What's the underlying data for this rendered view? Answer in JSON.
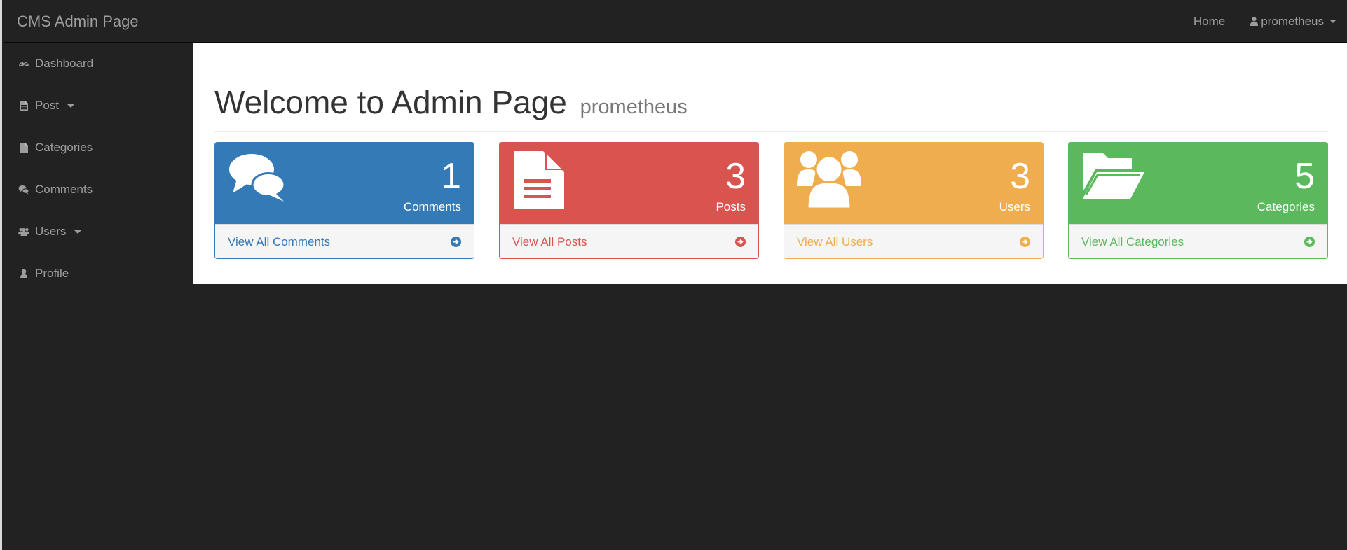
{
  "navbar": {
    "brand": "CMS Admin Page",
    "home": "Home",
    "user": "prometheus",
    "user_icon": "user-icon"
  },
  "sidebar": {
    "items": [
      {
        "label": "Dashboard",
        "icon": "dashboard-icon"
      },
      {
        "label": "Post",
        "icon": "file-text-icon",
        "dropdown": true
      },
      {
        "label": "Categories",
        "icon": "file-icon"
      },
      {
        "label": "Comments",
        "icon": "comments-icon"
      },
      {
        "label": "Users",
        "icon": "users-icon",
        "dropdown": true
      },
      {
        "label": "Profile",
        "icon": "user-icon"
      }
    ]
  },
  "main": {
    "title": "Welcome to Admin Page",
    "subtitle": "prometheus",
    "cards": [
      {
        "count": "1",
        "label": "Comments",
        "link": "View All Comments",
        "color": "#337ab7",
        "icon": "comments-icon"
      },
      {
        "count": "3",
        "label": "Posts",
        "link": "View All Posts",
        "color": "#d9534f",
        "icon": "file-text-icon"
      },
      {
        "count": "3",
        "label": "Users",
        "link": "View All Users",
        "color": "#f0ad4e",
        "icon": "users-icon"
      },
      {
        "count": "5",
        "label": "Categories",
        "link": "View All Categories",
        "color": "#5cb85c",
        "icon": "folder-open-icon"
      }
    ]
  },
  "colors": {
    "navbar_bg": "#222222",
    "nav_text": "#9d9d9d",
    "primary": "#337ab7",
    "danger": "#d9534f",
    "warning": "#f0ad4e",
    "success": "#5cb85c"
  }
}
